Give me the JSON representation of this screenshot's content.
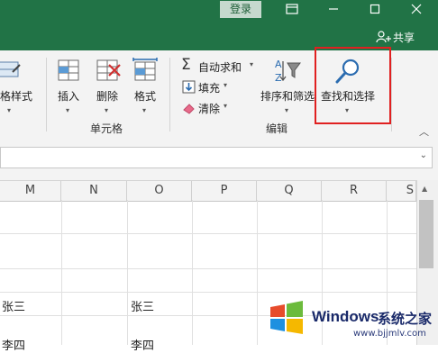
{
  "titlebar": {
    "login_label": "登录",
    "share_label": "共享",
    "icons": [
      "ribbon-display-icon",
      "minimize-icon",
      "maximize-icon",
      "close-icon",
      "user-icon"
    ]
  },
  "ribbon": {
    "partial_style_label": "格样式",
    "cells_group": {
      "label": "单元格",
      "insert_label": "插入",
      "delete_label": "删除",
      "format_label": "格式"
    },
    "edit_group": {
      "label": "编辑",
      "autosum_label": "自动求和",
      "fill_label": "填充",
      "clear_label": "清除",
      "sort_filter_label": "排序和筛选",
      "find_select_label": "查找和选择"
    }
  },
  "grid": {
    "columns": [
      "M",
      "N",
      "O",
      "P",
      "Q",
      "R",
      "S"
    ],
    "cells": [
      {
        "col": "M",
        "row": 6,
        "text": "张三"
      },
      {
        "col": "O",
        "row": 6,
        "text": "张三"
      },
      {
        "col": "M",
        "row": 7,
        "text": "李四"
      },
      {
        "col": "O",
        "row": 7,
        "text": "李四"
      }
    ]
  },
  "watermark": {
    "brand": "Windows",
    "site_name": "系统之家",
    "url": "www.bjjmlv.com"
  },
  "colors": {
    "title_bar": "#217346",
    "highlight": "#e02020",
    "ribbon_bg": "#f3f3f3"
  }
}
